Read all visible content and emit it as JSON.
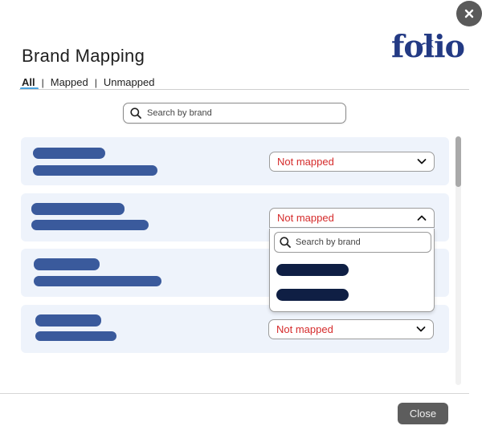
{
  "dialog": {
    "title": "Brand Mapping",
    "logo_text": "folio",
    "close_label": "Close"
  },
  "filters": {
    "items": [
      {
        "label": "All",
        "active": true
      },
      {
        "label": "Mapped",
        "active": false
      },
      {
        "label": "Unmapped",
        "active": false
      }
    ],
    "separator": "|"
  },
  "search": {
    "placeholder": "Search by brand",
    "value": ""
  },
  "rows": [
    {
      "status": "Not mapped",
      "expanded": false
    },
    {
      "status": "Not mapped",
      "expanded": true
    },
    {
      "status": "",
      "expanded": false
    },
    {
      "status": "Not mapped",
      "expanded": false
    }
  ],
  "dropdown": {
    "search_placeholder": "Search by brand",
    "option_count": 2
  },
  "colors": {
    "accent": "#4aa3df",
    "status_text": "#d52b2b",
    "bar_redacted": "#3a5a9c",
    "option_redacted": "#0f1f44",
    "row_bg": "#eef3fb",
    "logo": "#233a84"
  },
  "icons": [
    "close-icon",
    "search-icon",
    "chevron-down-icon",
    "chevron-up-icon"
  ]
}
